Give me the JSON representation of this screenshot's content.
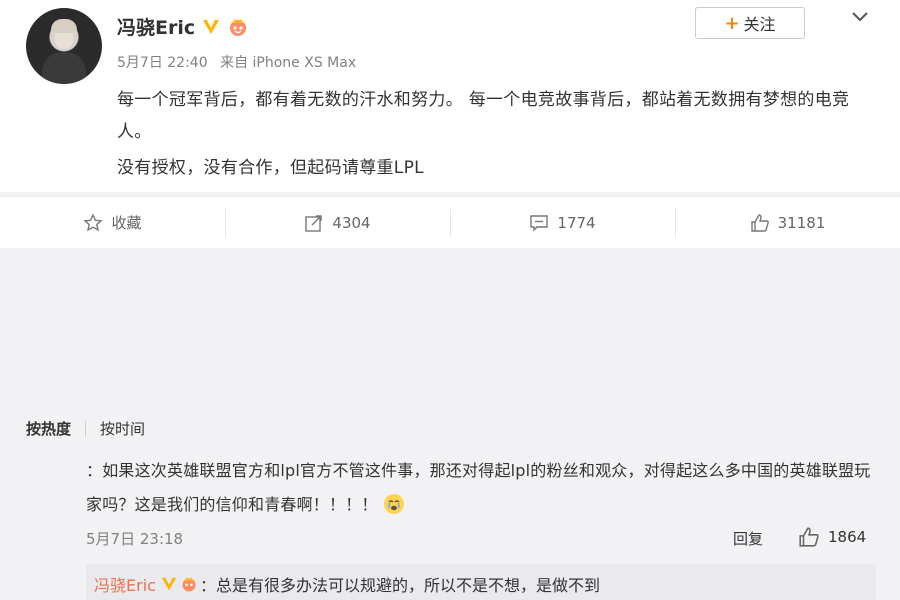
{
  "post": {
    "author": "冯骁Eric",
    "date": "5月7日 22:40",
    "source": "来自 iPhone XS Max",
    "follow_label": "关注",
    "paragraphs": [
      "每一个冠军背后，都有着无数的汗水和努力。 每一个电竞故事背后，都站着无数拥有梦想的电竞人。",
      "没有授权，没有合作，但起码请尊重LPL"
    ]
  },
  "actions": {
    "favorite_label": "收藏",
    "repost_count": "4304",
    "comment_count": "1774",
    "like_count": "31181"
  },
  "comments": {
    "sort_hot": "按热度",
    "sort_time": "按时间",
    "items": [
      {
        "text": "：如果这次英雄联盟官方和lpl官方不管这件事，那还对得起lpl的粉丝和观众，对得起这么多中国的英雄联盟玩家吗？这是我们的信仰和青春啊！！！！",
        "time": "5月7日 23:18",
        "reply_label": "回复",
        "like_count": "1864",
        "reply": {
          "author": "冯骁Eric",
          "text": "：总是有很多办法可以规避的，所以不是不想，是做不到"
        }
      }
    ]
  },
  "colors": {
    "accent": "#ff8200",
    "reply_author": "#eb7350",
    "verified": "#ffb400"
  }
}
